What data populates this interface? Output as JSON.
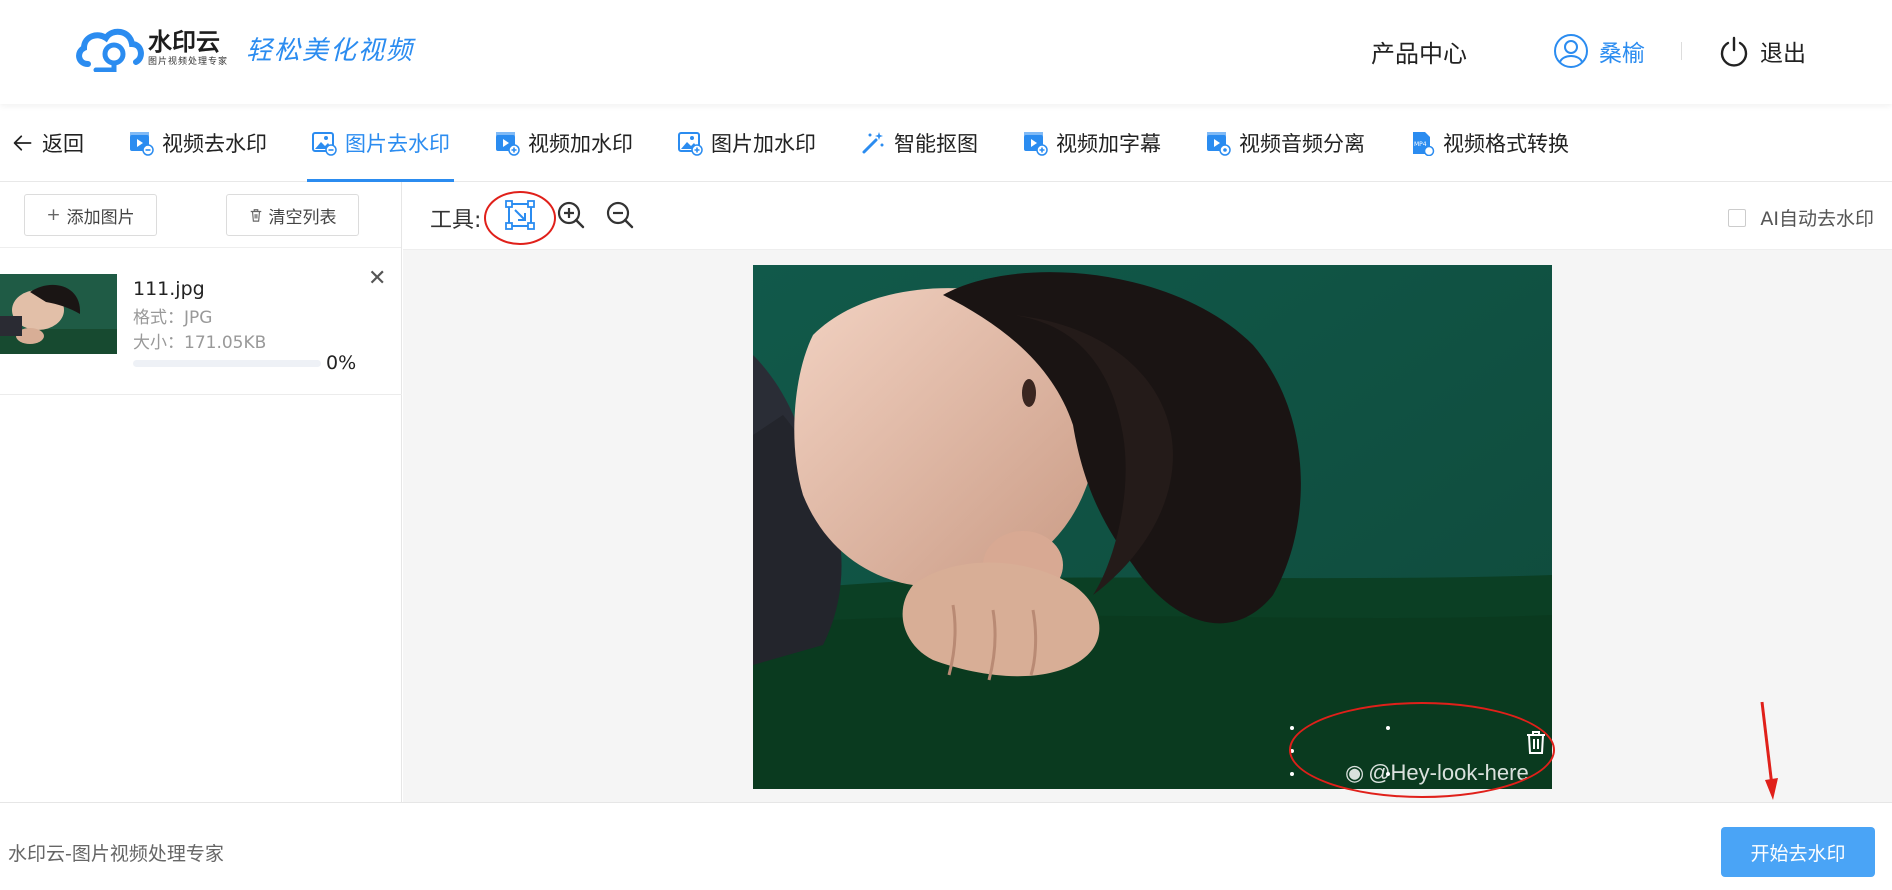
{
  "header": {
    "logo_name": "水印云",
    "logo_sub": "图片视频处理专家",
    "slogan": "轻松美化视频",
    "product_center": "产品中心",
    "username": "桑榆",
    "logout": "退出"
  },
  "nav": {
    "back": "返回",
    "tabs": [
      {
        "label": "视频去水印",
        "icon": "video-remove-watermark-icon"
      },
      {
        "label": "图片去水印",
        "icon": "image-remove-watermark-icon",
        "active": true
      },
      {
        "label": "视频加水印",
        "icon": "video-add-watermark-icon"
      },
      {
        "label": "图片加水印",
        "icon": "image-add-watermark-icon"
      },
      {
        "label": "智能抠图",
        "icon": "magic-wand-icon"
      },
      {
        "label": "视频加字幕",
        "icon": "video-subtitle-icon"
      },
      {
        "label": "视频音频分离",
        "icon": "video-audio-split-icon"
      },
      {
        "label": "视频格式转换",
        "icon": "mp4-convert-icon"
      }
    ]
  },
  "left": {
    "add_button": "添加图片",
    "clear_button": "清空列表",
    "file": {
      "name": "111.jpg",
      "format": "格式：JPG",
      "size": "大小：171.05KB",
      "progress_text": "0%",
      "progress": 0
    }
  },
  "toolbar": {
    "label": "工具:",
    "ai_auto": "AI自动去水印"
  },
  "canvas": {
    "watermark_text": "@Hey-look-here"
  },
  "footer": {
    "brand_text": "水印云-图片视频处理专家",
    "start_button": "开始去水印"
  },
  "colors": {
    "accent": "#2b8cf0",
    "start_button": "#4aa4f6",
    "annotation_red": "#e0201a"
  }
}
